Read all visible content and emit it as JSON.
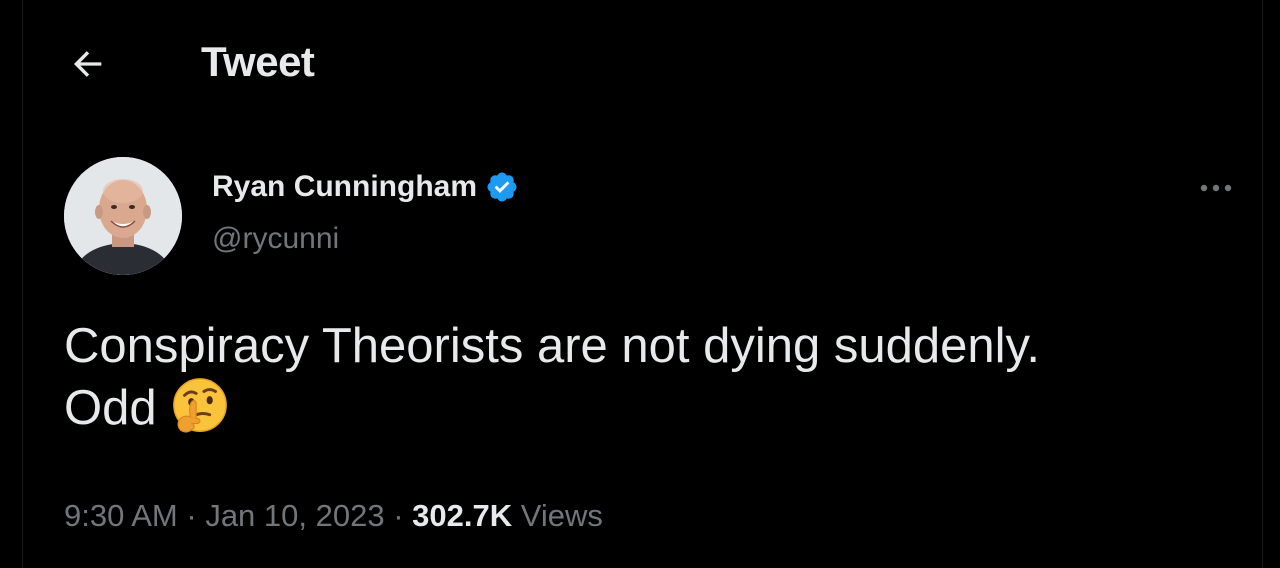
{
  "header": {
    "back_icon": "arrow-left-icon",
    "title": "Tweet"
  },
  "author": {
    "name": "Ryan Cunningham",
    "handle": "@rycunni",
    "verified_icon": "verified-badge-icon",
    "verified_color": "#1d9bf0"
  },
  "tweet": {
    "line1": "Conspiracy Theorists are not dying suddenly.",
    "line2": "Odd",
    "emoji": "thinking-face-emoji"
  },
  "meta": {
    "time": "9:30 AM",
    "separator1": " · ",
    "date": "Jan 10, 2023",
    "separator2": " · ",
    "views_count": "302.7K",
    "views_label": "Views"
  },
  "more_icon": "more-options-icon",
  "colors": {
    "background": "#000000",
    "primary_text": "#e7e9ea",
    "secondary_text": "#71767b",
    "accent": "#1d9bf0"
  }
}
